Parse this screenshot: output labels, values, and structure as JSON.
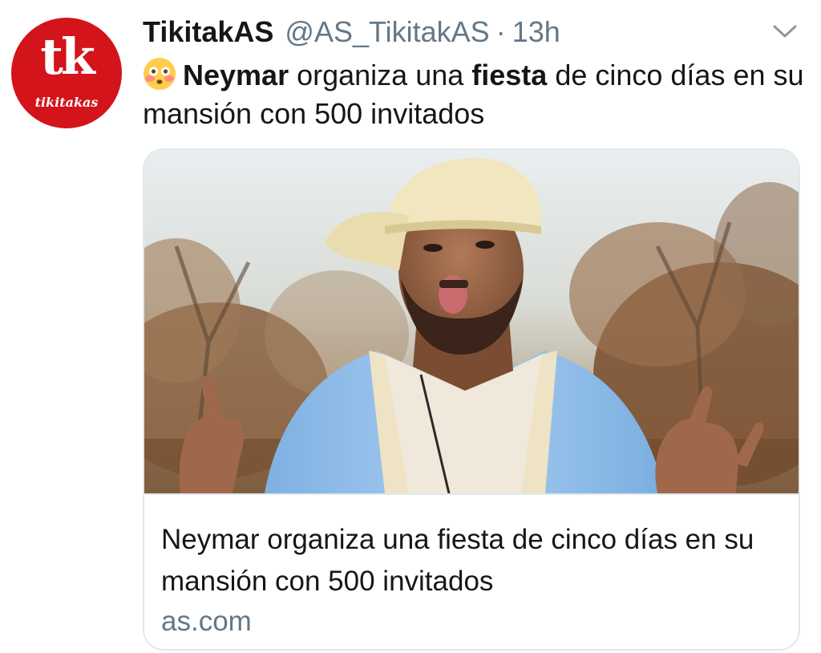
{
  "account": {
    "avatar_text": "tk",
    "avatar_wordmark": "tikitakas",
    "avatar_color": "#d3141b",
    "display_name": "TikitakAS",
    "handle": "@AS_TikitakAS",
    "separator": "·",
    "time": "13h"
  },
  "menu": {
    "icon": "chevron-down-icon"
  },
  "tweet": {
    "emoji": "flushed-face-emoji",
    "segments": [
      {
        "text": "Neymar",
        "bold": true
      },
      {
        "text": " organiza una ",
        "bold": false
      },
      {
        "text": "fiesta",
        "bold": true
      },
      {
        "text": " de cinco días en su mansión con 500 invitados",
        "bold": false
      }
    ]
  },
  "card": {
    "image": "photo-of-neymar-in-cap-sticking-out-tongue",
    "title": "Neymar organiza una fiesta de cinco días en su mansión con 500 invitados",
    "domain": "as.com"
  },
  "colors": {
    "text": "#14171a",
    "secondary": "#657786",
    "border": "#e1e8ed"
  }
}
